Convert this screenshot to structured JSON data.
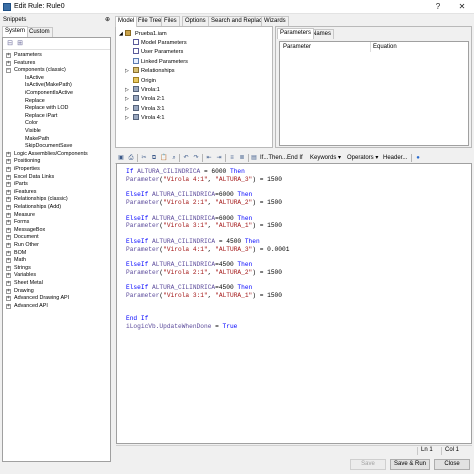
{
  "window": {
    "title": "Edit Rule: Rule0"
  },
  "snippets": {
    "header": "Snippets",
    "tabs": [
      "System",
      "Custom"
    ],
    "tree": [
      {
        "label": "Parameters",
        "toggle": "+",
        "depth": 0
      },
      {
        "label": "Features",
        "toggle": "+",
        "depth": 0
      },
      {
        "label": "Components (classic)",
        "toggle": "−",
        "depth": 0
      },
      {
        "label": "IsActive",
        "depth": 1
      },
      {
        "label": "IsActive(MakePath)",
        "depth": 1
      },
      {
        "label": "iComponentIsActive",
        "depth": 1
      },
      {
        "label": "Replace",
        "depth": 1
      },
      {
        "label": "Replace with LOD",
        "depth": 1
      },
      {
        "label": "Replace iPart",
        "depth": 1
      },
      {
        "label": "Color",
        "depth": 1
      },
      {
        "label": "Visible",
        "depth": 1
      },
      {
        "label": "MakePath",
        "depth": 1
      },
      {
        "label": "SkipDocumentSave",
        "depth": 1
      },
      {
        "label": "Logic Assemblies/Components",
        "toggle": "+",
        "depth": 0
      },
      {
        "label": "Positioning",
        "toggle": "+",
        "depth": 0
      },
      {
        "label": "iProperties",
        "toggle": "+",
        "depth": 0
      },
      {
        "label": "Excel Data Links",
        "toggle": "+",
        "depth": 0
      },
      {
        "label": "iParts",
        "toggle": "+",
        "depth": 0
      },
      {
        "label": "iFeatures",
        "toggle": "+",
        "depth": 0
      },
      {
        "label": "Relationships (classic)",
        "toggle": "+",
        "depth": 0
      },
      {
        "label": "Relationships (Add)",
        "toggle": "+",
        "depth": 0
      },
      {
        "label": "Measure",
        "toggle": "+",
        "depth": 0
      },
      {
        "label": "Forms",
        "toggle": "+",
        "depth": 0
      },
      {
        "label": "MessageBox",
        "toggle": "+",
        "depth": 0
      },
      {
        "label": "Document",
        "toggle": "+",
        "depth": 0
      },
      {
        "label": "Run Other",
        "toggle": "+",
        "depth": 0
      },
      {
        "label": "BOM",
        "toggle": "+",
        "depth": 0
      },
      {
        "label": "Math",
        "toggle": "+",
        "depth": 0
      },
      {
        "label": "Strings",
        "toggle": "+",
        "depth": 0
      },
      {
        "label": "Variables",
        "toggle": "+",
        "depth": 0
      },
      {
        "label": "Sheet Metal",
        "toggle": "+",
        "depth": 0
      },
      {
        "label": "Drawing",
        "toggle": "+",
        "depth": 0
      },
      {
        "label": "Advanced Drawing API",
        "toggle": "+",
        "depth": 0
      },
      {
        "label": "Advanced API",
        "toggle": "+",
        "depth": 0
      }
    ]
  },
  "main_tabs": [
    "Model",
    "File Tree",
    "Files",
    "Options",
    "Search and Replace",
    "Wizards"
  ],
  "model_tree": {
    "root": "Prueba1.iam",
    "items": [
      {
        "label": "Model Parameters",
        "icon": "fx-icon",
        "expander": false
      },
      {
        "label": "User Parameters",
        "icon": "fx-icon",
        "expander": false
      },
      {
        "label": "Linked Parameters",
        "icon": "link-icon",
        "expander": false
      },
      {
        "label": "Relationships",
        "icon": "relationship-icon",
        "expander": true
      },
      {
        "label": "Origin",
        "icon": "origin-folder-icon",
        "expander": false
      },
      {
        "label": "Virola:1",
        "icon": "part-icon",
        "expander": true
      },
      {
        "label": "Virola 2:1",
        "icon": "part-icon",
        "expander": true
      },
      {
        "label": "Virola 3:1",
        "icon": "part-icon",
        "expander": true
      },
      {
        "label": "Virola 4:1",
        "icon": "part-icon",
        "expander": true
      }
    ]
  },
  "params_panel": {
    "tabs": [
      "Parameters",
      "Names"
    ],
    "columns": [
      "Parameter",
      "Equation"
    ]
  },
  "editor_toolbar": {
    "if_then": "If...Then...End If",
    "keywords": "Keywords",
    "operators": "Operators",
    "header": "Header..."
  },
  "code": [
    [
      [
        "kw",
        "If "
      ],
      [
        "fn",
        "ALTURA_CILINDRICA"
      ],
      [
        "num",
        " = 6000 "
      ],
      [
        "kw",
        "Then"
      ]
    ],
    [
      [
        "fn",
        "Parameter"
      ],
      [
        "num",
        "("
      ],
      [
        "str",
        "\"Virola 4:1\""
      ],
      [
        "num",
        ", "
      ],
      [
        "str",
        "\"ALTURA_3\""
      ],
      [
        "num",
        ") = 1500"
      ]
    ],
    [],
    [
      [
        "kw",
        "ElseIf "
      ],
      [
        "fn",
        "ALTURA_CILINDRICA"
      ],
      [
        "num",
        "=6000 "
      ],
      [
        "kw",
        "Then"
      ]
    ],
    [
      [
        "fn",
        "Parameter"
      ],
      [
        "num",
        "("
      ],
      [
        "str",
        "\"Virola 2:1\""
      ],
      [
        "num",
        ", "
      ],
      [
        "str",
        "\"ALTURA_2\""
      ],
      [
        "num",
        ") = 1500"
      ]
    ],
    [],
    [
      [
        "kw",
        "ElseIf "
      ],
      [
        "fn",
        "ALTURA_CILINDRICA"
      ],
      [
        "num",
        "=6000 "
      ],
      [
        "kw",
        "Then"
      ]
    ],
    [
      [
        "fn",
        "Parameter"
      ],
      [
        "num",
        "("
      ],
      [
        "str",
        "\"Virola 3:1\""
      ],
      [
        "num",
        ", "
      ],
      [
        "str",
        "\"ALTURA_1\""
      ],
      [
        "num",
        ") = 1500"
      ]
    ],
    [],
    [
      [
        "kw",
        "ElseIf "
      ],
      [
        "fn",
        "ALTURA_CILINDRICA"
      ],
      [
        "num",
        " = 4500 "
      ],
      [
        "kw",
        "Then"
      ]
    ],
    [
      [
        "fn",
        "Parameter"
      ],
      [
        "num",
        "("
      ],
      [
        "str",
        "\"Virola 4:1\""
      ],
      [
        "num",
        ", "
      ],
      [
        "str",
        "\"ALTURA_3\""
      ],
      [
        "num",
        ") = 0.0001"
      ]
    ],
    [],
    [
      [
        "kw",
        "ElseIf "
      ],
      [
        "fn",
        "ALTURA_CILINDRICA"
      ],
      [
        "num",
        "=4500 "
      ],
      [
        "kw",
        "Then"
      ]
    ],
    [
      [
        "fn",
        "Parameter"
      ],
      [
        "num",
        "("
      ],
      [
        "str",
        "\"Virola 2:1\""
      ],
      [
        "num",
        ", "
      ],
      [
        "str",
        "\"ALTURA_2\""
      ],
      [
        "num",
        ") = 1500"
      ]
    ],
    [],
    [
      [
        "kw",
        "ElseIf "
      ],
      [
        "fn",
        "ALTURA_CILINDRICA"
      ],
      [
        "num",
        "=4500 "
      ],
      [
        "kw",
        "Then"
      ]
    ],
    [
      [
        "fn",
        "Parameter"
      ],
      [
        "num",
        "("
      ],
      [
        "str",
        "\"Virola 3:1\""
      ],
      [
        "num",
        ", "
      ],
      [
        "str",
        "\"ALTURA_1\""
      ],
      [
        "num",
        ") = 1500"
      ]
    ],
    [],
    [],
    [
      [
        "kw",
        "End If"
      ]
    ],
    [
      [
        "fn",
        "iLogicVb.UpdateWhenDone"
      ],
      [
        "num",
        " = "
      ],
      [
        "kw",
        "True"
      ]
    ]
  ],
  "status": {
    "line": "Ln 1",
    "col": "Col 1"
  },
  "buttons": {
    "ok": "Save",
    "save_run": "Save & Run",
    "close": "Close"
  },
  "colors": {
    "keyword": "#0000ff",
    "function": "#5b4a9b",
    "string": "#a31515"
  }
}
